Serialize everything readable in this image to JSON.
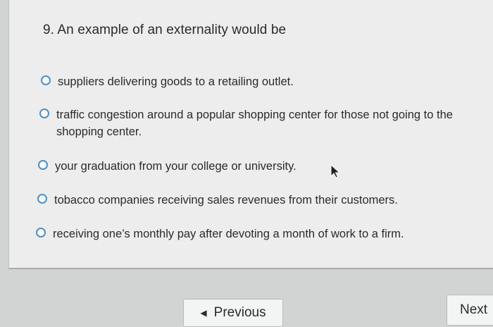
{
  "question": {
    "title": "9. An example of an externality would be"
  },
  "options": [
    {
      "label": "suppliers delivering goods to a retailing outlet.",
      "selected": false
    },
    {
      "label": "traffic congestion around a popular shopping center for those not going to the shopping center.",
      "selected": false
    },
    {
      "label": "your graduation from your college or university.",
      "selected": false
    },
    {
      "label": "tobacco companies receiving sales revenues from their customers.",
      "selected": false
    },
    {
      "label": "receiving one’s monthly pay after devoting a month of work to a firm.",
      "selected": false
    }
  ],
  "navigation": {
    "previous_label": "Previous",
    "previous_icon": "chevron-left-icon",
    "next_label": "Next"
  },
  "colors": {
    "radio_border": "#4f91c4",
    "card_background": "#ecedec",
    "page_background": "#d2d4d3"
  }
}
